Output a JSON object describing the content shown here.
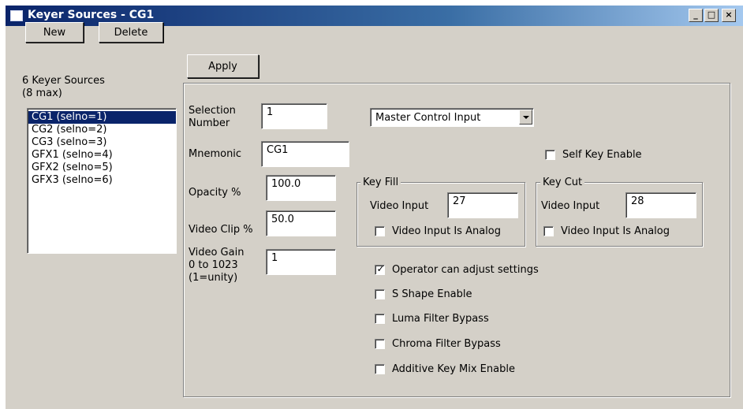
{
  "window": {
    "title": "Keyer Sources - CG1",
    "minimize_glyph": "_",
    "maximize_glyph": "□",
    "close_glyph": "×"
  },
  "left_panel": {
    "new_button": "New",
    "delete_button": "Delete",
    "count_line1": "6 Keyer Sources",
    "count_line2": "(8 max)",
    "sources": [
      {
        "label": "CG1 (selno=1)",
        "selected": true
      },
      {
        "label": "CG2 (selno=2)",
        "selected": false
      },
      {
        "label": "CG3 (selno=3)",
        "selected": false
      },
      {
        "label": "GFX1 (selno=4)",
        "selected": false
      },
      {
        "label": "GFX2 (selno=5)",
        "selected": false
      },
      {
        "label": "GFX3 (selno=6)",
        "selected": false
      }
    ]
  },
  "apply_button": "Apply",
  "form": {
    "selection_number_label_1": "Selection",
    "selection_number_label_2": "Number",
    "selection_number_value": "1",
    "input_select_value": "Master Control Input",
    "mnemonic_label": "Mnemonic",
    "mnemonic_value": "CG1",
    "self_key_enable_label": "Self Key Enable",
    "self_key_enable_checked": false,
    "opacity_label": "Opacity %",
    "opacity_value": "100.0",
    "video_clip_label": "Video Clip %",
    "video_clip_value": "50.0",
    "video_gain_label_1": "Video Gain",
    "video_gain_label_2": "0 to 1023",
    "video_gain_label_3": "(1=unity)",
    "video_gain_value": "1"
  },
  "key_fill": {
    "title": "Key Fill",
    "video_input_label": "Video Input",
    "video_input_value": "27",
    "analog_label": "Video Input Is Analog",
    "analog_checked": false
  },
  "key_cut": {
    "title": "Key Cut",
    "video_input_label": "Video Input",
    "video_input_value": "28",
    "analog_label": "Video Input Is Analog",
    "analog_checked": false
  },
  "options": [
    {
      "label": "Operator can adjust settings",
      "checked": true
    },
    {
      "label": "S Shape Enable",
      "checked": false
    },
    {
      "label": "Luma Filter Bypass",
      "checked": false
    },
    {
      "label": "Chroma Filter Bypass",
      "checked": false
    },
    {
      "label": "Additive Key Mix Enable",
      "checked": false
    }
  ],
  "colors": {
    "titlebar_start": "#0a246a",
    "titlebar_end": "#a6caf0",
    "face": "#d4d0c8",
    "selection": "#0a246a"
  }
}
